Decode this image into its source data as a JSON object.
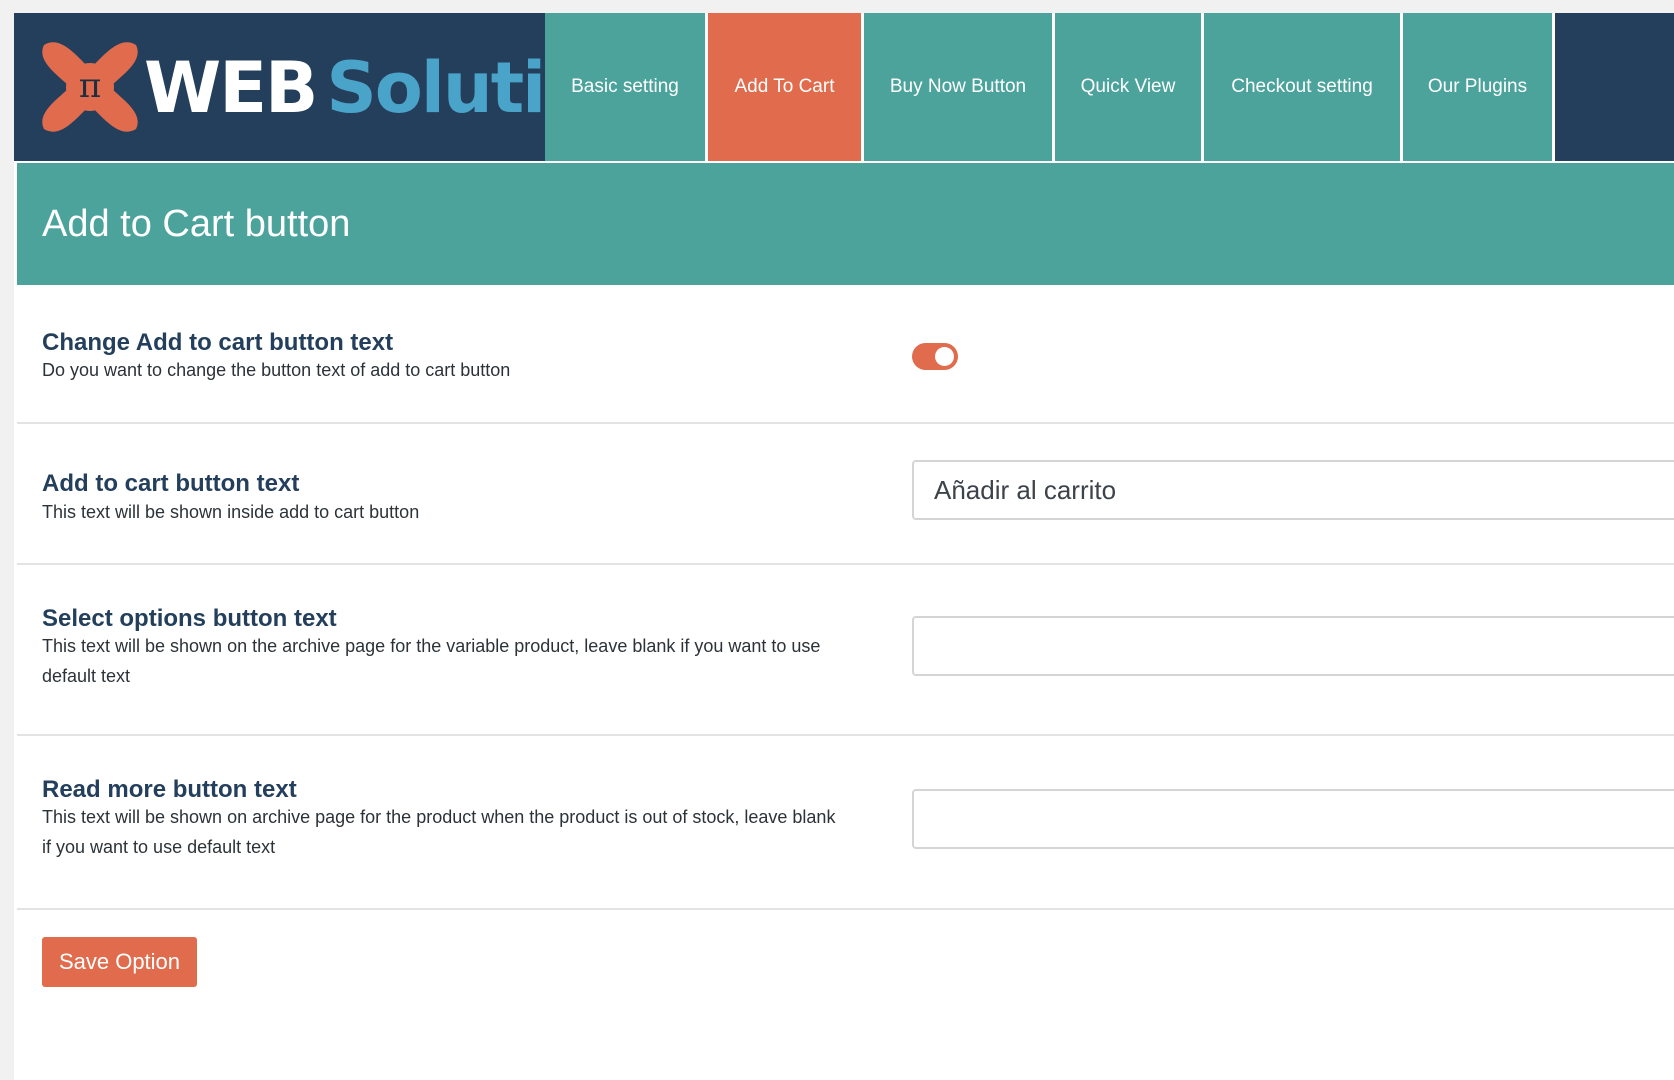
{
  "brand": {
    "word1": "WEB",
    "word2": "Solution",
    "symbol": "π"
  },
  "tabs": [
    {
      "label": "Basic setting",
      "active": false
    },
    {
      "label": "Add To Cart",
      "active": true
    },
    {
      "label": "Buy Now Button",
      "active": false
    },
    {
      "label": "Quick View",
      "active": false
    },
    {
      "label": "Checkout setting",
      "active": false
    },
    {
      "label": "Our Plugins",
      "active": false
    }
  ],
  "page": {
    "title": "Add to Cart button"
  },
  "settings": [
    {
      "label": "Change Add to cart button text",
      "description": "Do you want to change the button text of add to cart button",
      "type": "toggle",
      "enabled": true
    },
    {
      "label": "Add to cart button text",
      "description": "This text will be shown inside add to cart button",
      "type": "text",
      "value": "Añadir al carrito"
    },
    {
      "label": "Select options button text",
      "description": "This text will be shown on the archive page for the variable product, leave blank if you want to use default text",
      "type": "text",
      "value": ""
    },
    {
      "label": "Read more button text",
      "description": "This text will be shown on archive page for the product when the product is out of stock, leave blank if you want to use default text",
      "type": "text",
      "value": ""
    }
  ],
  "actions": {
    "save_label": "Save Option"
  },
  "colors": {
    "header_navy": "#243f5c",
    "teal": "#4ca39c",
    "accent_orange": "#e06c4d",
    "logo_blue": "#4aa3c9"
  }
}
